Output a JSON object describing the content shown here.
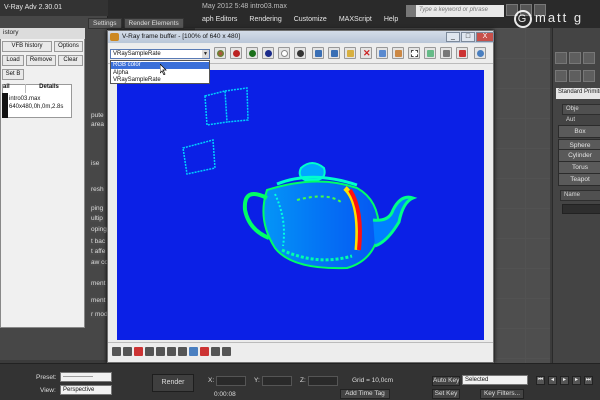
{
  "max": {
    "title_fragment": "May 2012  5:48     intro03.max",
    "menu": [
      "aph Editors",
      "Rendering",
      "Customize",
      "MAXScript",
      "Help"
    ],
    "search_placeholder": "Type a keyword or phrase",
    "watermark": "matt g",
    "command_panel": {
      "standard_primitives": "Standard Primiti",
      "object_type_header": "Obje",
      "autogrid": "Aut",
      "primitives": [
        "Box",
        "Sphere",
        "Cylinder",
        "Torus",
        "Teapot"
      ],
      "name_header": "Name"
    }
  },
  "vray_adv": {
    "title": "V-Ray Adv 2.30.01",
    "tabs": [
      "Settings",
      "Render Elements"
    ],
    "side_labels": [
      "pute",
      "area",
      "ise",
      "resh",
      "ping",
      "ultip",
      "oping",
      "t bac",
      "t affe",
      "aw co",
      "ment",
      "ment",
      "r mod"
    ]
  },
  "history": {
    "title": "istory",
    "buttons": {
      "vfb_history": "VFB history",
      "options": "Options",
      "load": "Load",
      "remove": "Remove",
      "clear": "Clear",
      "set_b": "Set B"
    },
    "columns": [
      "ail",
      "Details"
    ],
    "rows": [
      {
        "file": "intro03.max",
        "details": "640x480,0h,0m,2.8s"
      }
    ]
  },
  "vfb": {
    "title": "V-Ray frame buffer - [100% of 640 x 480]",
    "channel_selected": "VRaySampleRate",
    "channel_options": [
      "RGB color",
      "Alpha",
      "VRaySampleRate"
    ],
    "hovered_option": "RGB color",
    "window_buttons": [
      "_",
      "□",
      "X"
    ],
    "colors": {
      "background": "#0b20e6",
      "edge_cyan": "#00e5ff",
      "edge_green": "#22ff22",
      "edge_yellow": "#ffe000",
      "edge_red": "#ff1010"
    }
  },
  "bottom": {
    "preset_label": "Preset:",
    "preset_value": "---------------",
    "view_label": "View:",
    "view_value": "Perspective",
    "render_button": "Render",
    "x_label": "X:",
    "y_label": "Y:",
    "z_label": "Z:",
    "grid": "Grid = 10,0cm",
    "time": "0:00:08",
    "add_time_tag": "Add Time Tag",
    "auto_key": "Auto Key",
    "set_key": "Set Key",
    "selected": "Selected",
    "key_filters": "Key Filters..."
  }
}
